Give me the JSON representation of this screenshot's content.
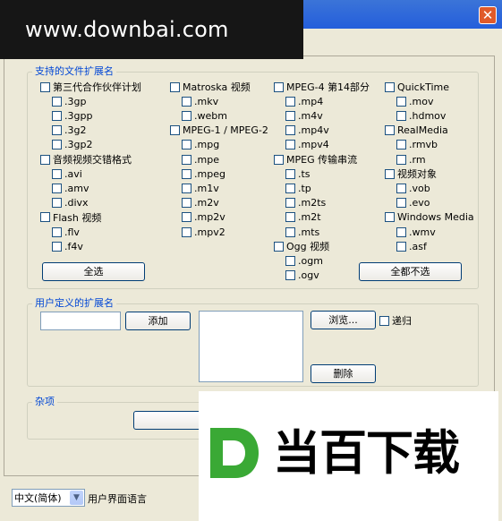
{
  "title_bar": {
    "close_glyph": "✕"
  },
  "watermark_top": {
    "text": "www.downbai.com"
  },
  "watermark_bottom": {
    "text": "当百下载",
    "logo_letter": "D",
    "logo_color": "#3aa935"
  },
  "supported": {
    "legend": "支持的文件扩展名",
    "col1": [
      {
        "label": "第三代合作伙伴计划",
        "children": [
          ".3gp",
          ".3gpp",
          ".3g2",
          ".3gp2"
        ]
      },
      {
        "label": "音频视频交错格式",
        "children": [
          ".avi",
          ".amv",
          ".divx"
        ]
      },
      {
        "label": "Flash 视频",
        "children": [
          ".flv",
          ".f4v"
        ]
      }
    ],
    "col2": [
      {
        "label": "Matroska 视频",
        "children": [
          ".mkv",
          ".webm"
        ]
      },
      {
        "label": "MPEG-1 / MPEG-2",
        "children": [
          ".mpg",
          ".mpe",
          ".mpeg",
          ".m1v",
          ".m2v",
          ".mp2v",
          ".mpv2"
        ]
      }
    ],
    "col3": [
      {
        "label": "MPEG-4 第14部分",
        "children": [
          ".mp4",
          ".m4v",
          ".mp4v",
          ".mpv4"
        ]
      },
      {
        "label": "MPEG 传输串流",
        "children": [
          ".ts",
          ".tp",
          ".m2ts",
          ".m2t",
          ".mts"
        ]
      },
      {
        "label": "Ogg 视频",
        "children": [
          ".ogm",
          ".ogv"
        ]
      }
    ],
    "col4": [
      {
        "label": "QuickTime",
        "children": [
          ".mov",
          ".hdmov"
        ]
      },
      {
        "label": "RealMedia",
        "children": [
          ".rmvb",
          ".rm"
        ]
      },
      {
        "label": "视频对象",
        "children": [
          ".vob",
          ".evo"
        ]
      },
      {
        "label": "Windows Media",
        "children": [
          ".wmv",
          ".asf"
        ]
      }
    ],
    "select_all": "全选",
    "select_none": "全都不选"
  },
  "custom": {
    "legend": "用户定义的扩展名",
    "input_value": "",
    "add": "添加",
    "browse": "浏览...",
    "recursive": "递归",
    "delete": "删除"
  },
  "misc": {
    "legend": "杂项"
  },
  "language": {
    "value": "中文(简体)",
    "label": "用户界面语言",
    "arrow": "▼"
  }
}
